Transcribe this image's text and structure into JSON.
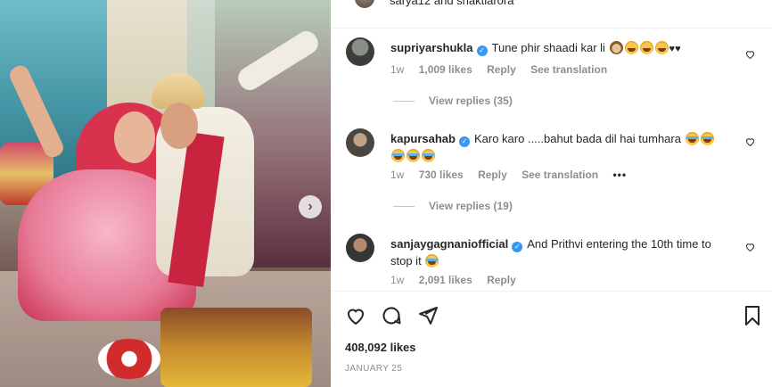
{
  "header": {
    "liked_by_text": "sarya12 and shaktiarora",
    "more_icon": "more-icon"
  },
  "comments": [
    {
      "username": "supriyarshukla",
      "verified": true,
      "text": "Tune phir shaadi kar li",
      "emojis": [
        "see-no-evil-monkey",
        "grinning",
        "grinning",
        "grinning",
        "black-heart",
        "black-heart"
      ],
      "age": "1w",
      "likes": "1,009 likes",
      "reply": "Reply",
      "translate": "See translation",
      "view_replies": "View replies (35)"
    },
    {
      "username": "kapursahab",
      "verified": true,
      "text": "Karo karo .....bahut bada dil hai tumhara",
      "emojis": [
        "tears-of-joy",
        "tears-of-joy",
        "tears-of-joy",
        "tears-of-joy",
        "tears-of-joy"
      ],
      "age": "1w",
      "likes": "730 likes",
      "reply": "Reply",
      "translate": "See translation",
      "more": "•••",
      "view_replies": "View replies (19)"
    },
    {
      "username": "sanjaygagnaniofficial",
      "verified": true,
      "text": "And Prithvi entering the 10th time to stop it",
      "emojis": [
        "tears-of-joy"
      ],
      "age": "1w",
      "likes": "2,091 likes",
      "reply": "Reply"
    }
  ],
  "post": {
    "likes": "408,092 likes",
    "date": "JANUARY 25"
  },
  "icons": [
    "heart-icon",
    "comment-icon",
    "share-icon",
    "bookmark-icon",
    "chevron-right-icon",
    "verified-icon"
  ],
  "colors": {
    "verified": "#3897f0",
    "muted_text": "#8e8e8e",
    "primary_text": "#262626"
  }
}
